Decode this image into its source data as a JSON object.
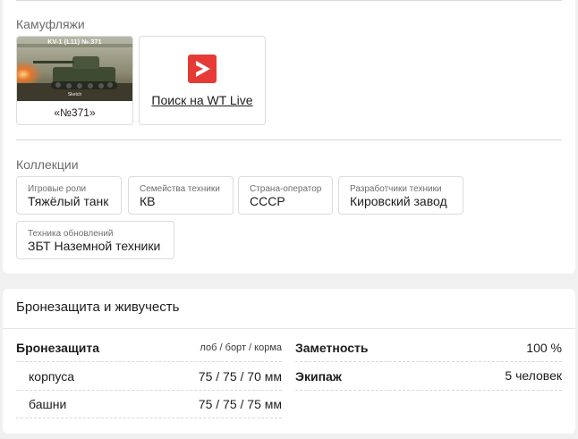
{
  "camouflage": {
    "title": "Камуфляжи",
    "items": [
      {
        "image_label": "KV-1 (L11) №.371",
        "image_sub": "Sketch",
        "caption": "«№371»"
      }
    ],
    "wt_live": {
      "label": "Поиск на WT Live"
    }
  },
  "collections": {
    "title": "Коллекции",
    "chips": [
      {
        "label": "Игровые роли",
        "value": "Тяжёлый танк"
      },
      {
        "label": "Семейства техники",
        "value": "КВ"
      },
      {
        "label": "Страна-оператор",
        "value": "СССР"
      },
      {
        "label": "Разработчики техники",
        "value": "Кировский завод"
      },
      {
        "label": "Техника обновлений",
        "value": "ЗБТ Наземной техники"
      }
    ]
  },
  "armor": {
    "title": "Бронезащита и живучесть",
    "armor_label": "Бронезащита",
    "armor_axes": "лоб / борт / корма",
    "rows": [
      {
        "label": "корпуса",
        "value": "75 / 75 / 70 мм"
      },
      {
        "label": "башни",
        "value": "75 / 75 / 75 мм"
      }
    ],
    "visibility_label": "Заметность",
    "visibility_value": "100 %",
    "crew_label": "Экипаж",
    "crew_value": "5 человек"
  }
}
